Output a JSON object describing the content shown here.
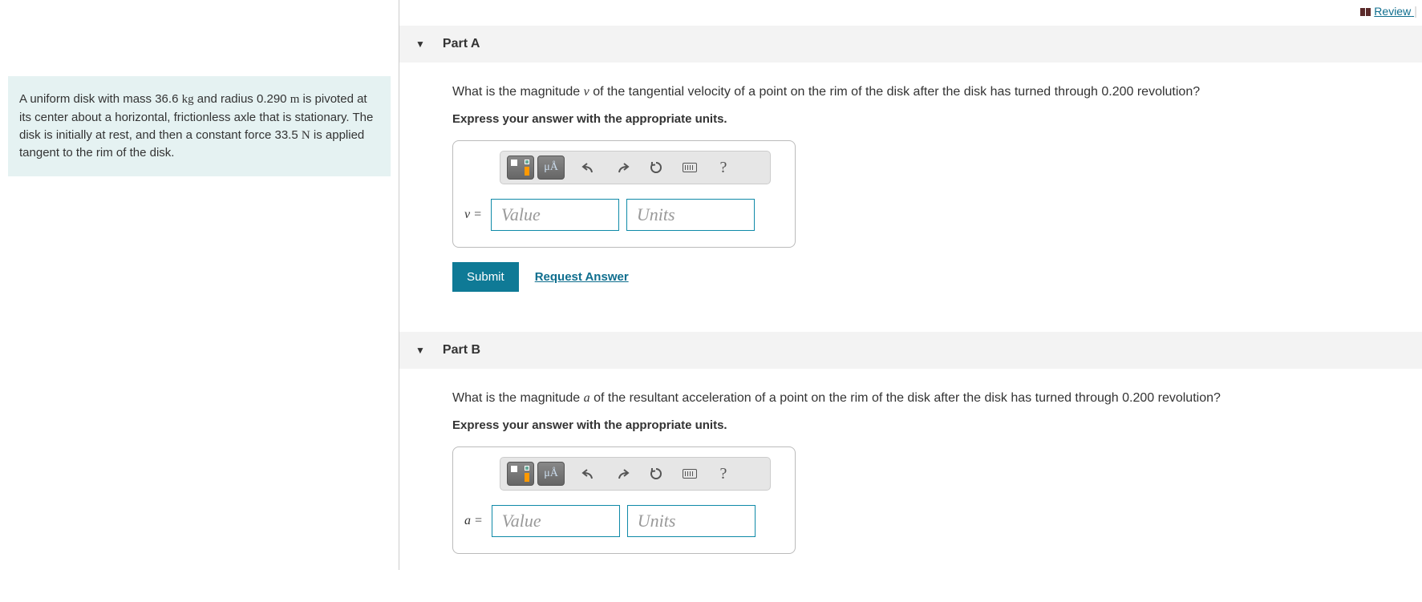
{
  "topbar": {
    "review": "Review"
  },
  "problem": {
    "text_before_mass": "A uniform disk with mass ",
    "mass_val": "36.6",
    "mass_unit": "kg",
    "text_after_mass": " and radius ",
    "radius_val": "0.290",
    "radius_unit": "m",
    "text_after_radius": " is pivoted at its center about a horizontal, frictionless axle that is stationary. The disk is initially at rest, and then a constant force ",
    "force_val": "33.5",
    "force_unit": "N",
    "text_after_force": " is applied tangent to the rim of the disk."
  },
  "partA": {
    "title": "Part A",
    "q_prefix": "What is the magnitude ",
    "q_var": "v",
    "q_suffix": " of the tangential velocity of a point on the rim of the disk after the disk has turned through 0.200 revolution?",
    "instr": "Express your answer with the appropriate units.",
    "var_label": "v =",
    "value_ph": "Value",
    "units_ph": "Units",
    "symbols_label": "μÅ",
    "help_label": "?"
  },
  "partB": {
    "title": "Part B",
    "q_prefix": "What is the magnitude ",
    "q_var": "a",
    "q_suffix": " of the resultant acceleration of a point on the rim of the disk after the disk has turned through 0.200 revolution?",
    "instr": "Express your answer with the appropriate units.",
    "var_label": "a =",
    "value_ph": "Value",
    "units_ph": "Units",
    "symbols_label": "μÅ",
    "help_label": "?"
  },
  "actions": {
    "submit": "Submit",
    "request": "Request Answer"
  }
}
